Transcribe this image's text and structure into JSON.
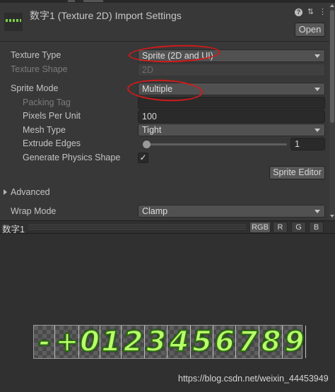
{
  "window": {
    "title": "数字1 (Texture 2D) Import Settings",
    "open_button": "Open"
  },
  "settings": {
    "texture_type": {
      "label": "Texture Type",
      "value": "Sprite (2D and UI)"
    },
    "texture_shape": {
      "label": "Texture Shape",
      "value": "2D"
    },
    "sprite_mode": {
      "label": "Sprite Mode",
      "value": "Multiple"
    },
    "packing_tag": {
      "label": "Packing Tag",
      "value": ""
    },
    "pixels_per_unit": {
      "label": "Pixels Per Unit",
      "value": "100"
    },
    "mesh_type": {
      "label": "Mesh Type",
      "value": "Tight"
    },
    "extrude_edges": {
      "label": "Extrude Edges",
      "value": "1",
      "slider_fraction": 0.0
    },
    "generate_physics_shape": {
      "label": "Generate Physics Shape",
      "checked": true,
      "mark": "✓"
    },
    "sprite_editor_button": "Sprite Editor",
    "advanced": "Advanced",
    "wrap_mode": {
      "label": "Wrap Mode",
      "value": "Clamp"
    }
  },
  "preview": {
    "name": "数字1",
    "channels": [
      "RGB",
      "R",
      "G",
      "B"
    ],
    "active_channel": "RGB",
    "glyphs": [
      "-",
      "+",
      "0",
      "1",
      "2",
      "3",
      "4",
      "5",
      "6",
      "7",
      "8",
      "9"
    ]
  },
  "watermark": "https://blog.csdn.net/weixin_44453949",
  "colors": {
    "annotation": "#d01a1a",
    "glyph_fill": "#b9ff6a",
    "glyph_outline": "#2c6a12"
  }
}
